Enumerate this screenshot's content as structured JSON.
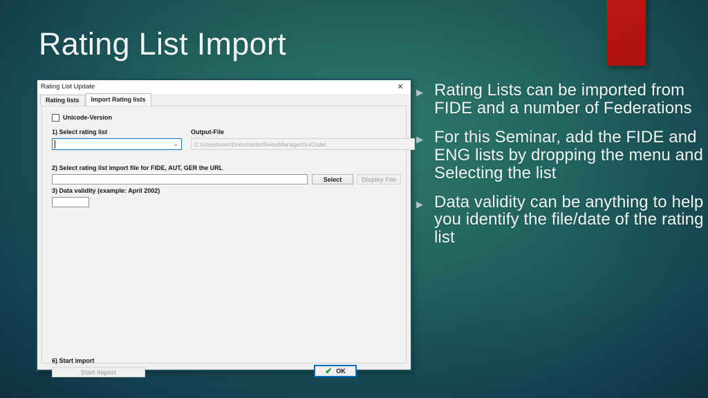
{
  "slide": {
    "title": "Rating List Import",
    "bullet_marker": "▶",
    "bullets": [
      "Rating Lists can be imported from FIDE and a number of Federations",
      "For this Seminar, add the FIDE and ENG lists by dropping the menu and Selecting the list",
      "Data validity can be anything to help you identify the file/date of the rating list"
    ]
  },
  "dialog": {
    "title": "Rating List Update",
    "close_glyph": "✕",
    "tabs": [
      {
        "label": "Rating lists",
        "active": false
      },
      {
        "label": "Import Rating lists",
        "active": true
      }
    ],
    "unicode_checkbox": {
      "label": "Unicode-Version",
      "checked": false
    },
    "step1": {
      "label": "1) Select rating list",
      "combo_value": "",
      "combo_caret": "⌄"
    },
    "output_file": {
      "label": "Output-File",
      "value": "C:\\Users\\user\\Documents\\SwissManagerUniCode\\"
    },
    "step2": {
      "label": "2) Select rating list import file for FIDE, AUT, GER the URL",
      "input_value": "",
      "select_button": "Select",
      "display_file_button": "Display File"
    },
    "step3": {
      "label": "3) Data validity (example: April 2002)",
      "input_value": ""
    },
    "step6": {
      "label": "6) Start import",
      "start_button": "Start import"
    },
    "ok_button": {
      "label": "OK",
      "check_glyph": "✔"
    }
  },
  "theme": {
    "accent_red": "#b3140f",
    "focus_blue": "#0a6cc4",
    "check_green": "#149a14",
    "bg_teal": "#2b7068",
    "bg_dark": "#133f52",
    "title_text": "#f2f5f4"
  }
}
